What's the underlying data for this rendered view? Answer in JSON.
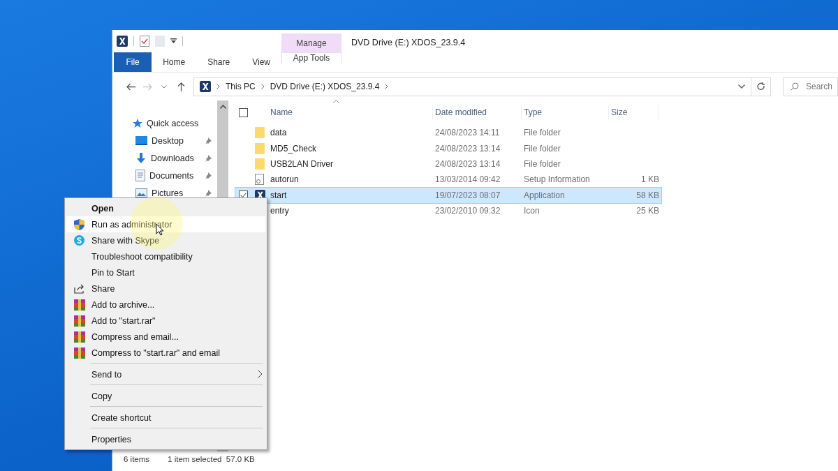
{
  "window": {
    "title": "DVD Drive (E:) XDOS_23.9.4"
  },
  "quick_access_toolbar": [
    {
      "kind": "app"
    },
    {
      "kind": "properties"
    },
    {
      "kind": "newfolder"
    },
    {
      "kind": "customize"
    }
  ],
  "ribbon": {
    "context_group": "Manage",
    "tabs": [
      {
        "label": "File",
        "kind": "file"
      },
      {
        "label": "Home",
        "kind": "normal"
      },
      {
        "label": "Share",
        "kind": "normal"
      },
      {
        "label": "View",
        "kind": "normal"
      },
      {
        "label": "App Tools",
        "kind": "contextual"
      }
    ]
  },
  "address_bar": {
    "breadcrumbs": [
      "This PC",
      "DVD Drive (E:) XDOS_23.9.4"
    ]
  },
  "search": {
    "placeholder": "Search"
  },
  "navigation": [
    {
      "label": "Quick access",
      "kind": "star",
      "pinned": false
    },
    {
      "label": "Desktop",
      "kind": "desktop",
      "pinned": true
    },
    {
      "label": "Downloads",
      "kind": "downloads",
      "pinned": true
    },
    {
      "label": "Documents",
      "kind": "documents",
      "pinned": true
    },
    {
      "label": "Pictures",
      "kind": "pictures",
      "pinned": true
    }
  ],
  "columns": [
    "Name",
    "Date modified",
    "Type",
    "Size"
  ],
  "select_all": {
    "checked": false
  },
  "files": [
    {
      "name": "data",
      "date": "24/08/2023 14:11",
      "type": "File folder",
      "kind": "folder",
      "selected": false
    },
    {
      "name": "MD5_Check",
      "date": "24/08/2023 13:14",
      "type": "File folder",
      "kind": "folder",
      "selected": false
    },
    {
      "name": "USB2LAN Driver",
      "date": "24/08/2023 13:14",
      "type": "File folder",
      "kind": "folder",
      "selected": false
    },
    {
      "name": "autorun",
      "date": "13/03/2014 09:42",
      "type": "Setup Information",
      "size": "1 KB",
      "kind": "inf",
      "selected": false
    },
    {
      "name": "start",
      "date": "19/07/2023 08:07",
      "type": "Application",
      "size": "58 KB",
      "kind": "app",
      "selected": true
    },
    {
      "name": "entry",
      "date": "23/02/2010 09:32",
      "type": "Icon",
      "size": "25 KB",
      "selected": false
    }
  ],
  "status_bar": {
    "count": "6 items",
    "selection": "1 item selected  57.0 KB"
  },
  "context_menu": [
    [
      {
        "label": "Open",
        "kind": "default",
        "highlighted": false
      },
      {
        "label": "Run as administrator",
        "kind": "shield",
        "highlighted": true
      },
      {
        "label": "Share with Skype",
        "kind": "skype",
        "highlighted": false
      },
      {
        "label": "Troubleshoot compatibility",
        "kind": "plain",
        "highlighted": false
      },
      {
        "label": "Pin to Start",
        "kind": "plain",
        "highlighted": false
      },
      {
        "label": "Share",
        "kind": "share",
        "highlighted": false
      },
      {
        "label": "Add to archive...",
        "kind": "archive",
        "highlighted": false
      },
      {
        "label": "Add to \"start.rar\"",
        "kind": "archive",
        "highlighted": false
      },
      {
        "label": "Compress and email...",
        "kind": "archive",
        "highlighted": false
      },
      {
        "label": "Compress to \"start.rar\" and email",
        "kind": "archive",
        "highlighted": false
      }
    ],
    [
      {
        "label": "Send to",
        "kind": "submenu",
        "highlighted": false
      }
    ],
    [
      {
        "label": "Copy",
        "kind": "plain",
        "highlighted": false
      }
    ],
    [
      {
        "label": "Create shortcut",
        "kind": "plain",
        "highlighted": false
      }
    ],
    [
      {
        "label": "Properties",
        "kind": "plain",
        "highlighted": false
      }
    ]
  ]
}
